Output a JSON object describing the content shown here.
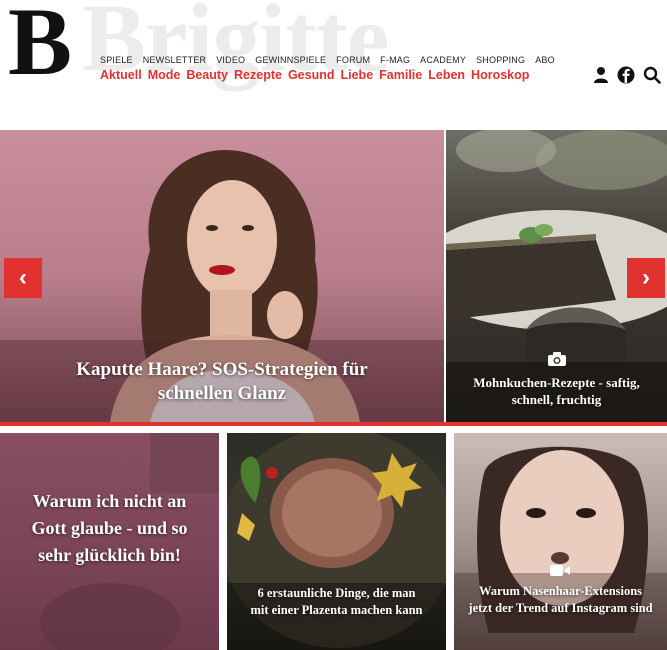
{
  "header": {
    "logo": "Brigitte",
    "logo_initial": "B",
    "top_links": [
      "SPIELE",
      "NEWSLETTER",
      "VIDEO",
      "GEWINNSPIELE",
      "FORUM",
      "F-MAG",
      "ACADEMY",
      "SHOPPING",
      "ABO"
    ],
    "main_links": [
      "Aktuell",
      "Mode",
      "Beauty",
      "Rezepte",
      "Gesund",
      "Liebe",
      "Familie",
      "Leben",
      "Horoskop"
    ],
    "icons": [
      "user-icon",
      "facebook-icon",
      "search-icon"
    ]
  },
  "hero": {
    "main_caption": "Kaputte Haare? SOS-Strategien für schnellen Glanz",
    "side_caption": "Mohnkuchen-Rezepte - saftig, schnell, fruchtig",
    "side_icon": "camera-icon",
    "prev_label": "‹",
    "next_label": "›"
  },
  "tiles": [
    {
      "caption": "Warum ich nicht an Gott glaube - und so sehr glücklich bin!"
    },
    {
      "caption": "6 erstaunliche Dinge, die man mit einer Plazenta machen kann"
    },
    {
      "caption": "Warum Nasenhaar-Extensions jetzt der Trend auf Instagram sind",
      "icon": "video-icon"
    }
  ],
  "colors": {
    "accent": "#e1322f",
    "text": "#222222"
  }
}
